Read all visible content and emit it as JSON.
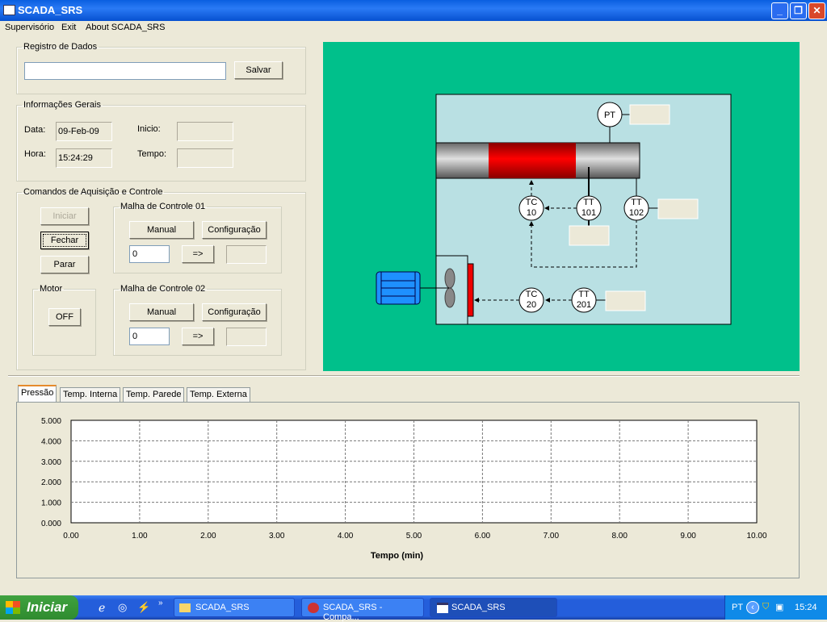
{
  "window": {
    "title": "SCADA_SRS",
    "minimize": "_",
    "maximize": "❐",
    "close": "✕"
  },
  "menu": [
    "Supervisório",
    "Exit",
    "About SCADA_SRS"
  ],
  "registro": {
    "legend": "Registro de Dados",
    "input_value": "",
    "save_label": "Salvar"
  },
  "info": {
    "legend": "Informações Gerais",
    "data_label": "Data:",
    "data_value": "09-Feb-09",
    "hora_label": "Hora:",
    "hora_value": "15:24:29",
    "inicio_label": "Inicio:",
    "inicio_value": "",
    "tempo_label": "Tempo:",
    "tempo_value": ""
  },
  "comandos": {
    "legend": "Comandos de Aquisição e Controle",
    "iniciar": "Iniciar",
    "fechar": "Fechar",
    "parar": "Parar",
    "motor": {
      "legend": "Motor",
      "button": "OFF"
    },
    "malha1": {
      "legend": "Malha de Controle 01",
      "manual": "Manual",
      "config": "Configuração",
      "value": "0",
      "send": "=>",
      "output": ""
    },
    "malha2": {
      "legend": "Malha de Controle 02",
      "manual": "Manual",
      "config": "Configuração",
      "value": "0",
      "send": "=>",
      "output": ""
    }
  },
  "diagram": {
    "colors": {
      "background": "#00c08b",
      "panel": "#b9e0e3",
      "heater": "#ff0000",
      "motor": "#1e90ff"
    },
    "instruments": {
      "pt": "PT",
      "tc10": [
        "TC",
        "10"
      ],
      "tt101": [
        "TT",
        "101"
      ],
      "tt102": [
        "TT",
        "102"
      ],
      "tc20": [
        "TC",
        "20"
      ],
      "tt201": [
        "TT",
        "201"
      ]
    }
  },
  "tabs": [
    "Pressão",
    "Temp. Interna",
    "Temp. Parede",
    "Temp. Externa"
  ],
  "active_tab": 0,
  "chart_data": {
    "type": "line",
    "series": [],
    "xlabel": "Tempo (min)",
    "ylabel": "",
    "xlim": [
      0,
      10
    ],
    "ylim": [
      0,
      5
    ],
    "grid": true,
    "x_ticks": [
      "0.00",
      "1.00",
      "2.00",
      "3.00",
      "4.00",
      "5.00",
      "6.00",
      "7.00",
      "8.00",
      "9.00",
      "10.00"
    ],
    "y_ticks": [
      "0.000",
      "1.000",
      "2.000",
      "3.000",
      "4.000",
      "5.000"
    ]
  },
  "taskbar": {
    "start": "Iniciar",
    "tasks": [
      "SCADA_SRS",
      "SCADA_SRS - Compa...",
      "SCADA_SRS"
    ],
    "lang": "PT",
    "clock": "15:24"
  }
}
